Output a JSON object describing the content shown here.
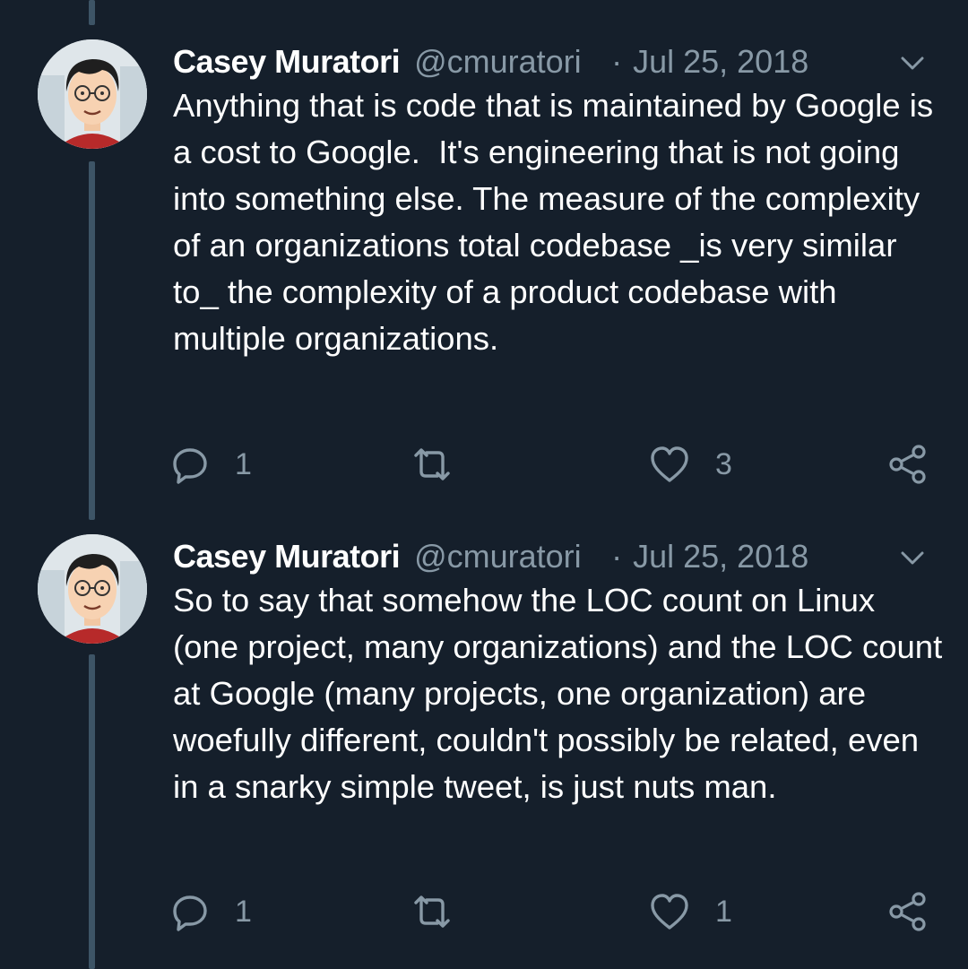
{
  "tweets": [
    {
      "author_name": "Casey Muratori",
      "author_handle": "@cmuratori",
      "separator": "·",
      "date": "Jul 25, 2018",
      "text": "Anything that is code that is maintained by Google is a cost to Google.  It's engineering that is not going into something else. The measure of the complexity of an organizations total codebase _is very similar to_ the complexity of a product codebase with multiple organizations.",
      "reply_count": "1",
      "retweet_count": "",
      "like_count": "3",
      "icons": {
        "reply": "reply-icon",
        "retweet": "retweet-icon",
        "like": "heart-icon",
        "share": "share-icon",
        "more": "chevron-down-icon"
      }
    },
    {
      "author_name": "Casey Muratori",
      "author_handle": "@cmuratori",
      "separator": "·",
      "date": "Jul 25, 2018",
      "text": "So to say that somehow the LOC count on Linux (one project, many organizations) and the LOC count at Google (many projects, one organization) are woefully different, couldn't possibly be related, even in a snarky simple tweet, is just nuts man.",
      "reply_count": "1",
      "retweet_count": "",
      "like_count": "1",
      "icons": {
        "reply": "reply-icon",
        "retweet": "retweet-icon",
        "like": "heart-icon",
        "share": "share-icon",
        "more": "chevron-down-icon"
      }
    }
  ],
  "colors": {
    "background": "#151f2b",
    "text": "#ffffff",
    "secondary_text": "#8899a6",
    "thread_line": "#3d5466"
  }
}
